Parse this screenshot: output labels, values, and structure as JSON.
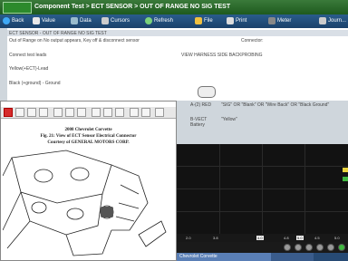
{
  "app": {
    "title": "Component Test > ECT SENSOR > OUT OF RANGE NO SIG TEST"
  },
  "toolbar": {
    "back": "Back",
    "value": "Value",
    "data": "Data",
    "cursors": "Cursors",
    "refresh": "Refresh",
    "file": "File",
    "print": "Print",
    "meter": "Meter",
    "journal": "Journ..."
  },
  "test": {
    "header": "ECT SENSOR - OUT OF RANGE NO SIG TEST",
    "instruction": "Out of Range on No output appears, Key off & disconnect sensor",
    "connect_test_leads": "Connect test leads",
    "yellow_label": "Yellow(+ECT)-Lead",
    "black_label": "Black (+ground) - Ground",
    "connector_label": "Connector:",
    "connector_value": "VIEW HARNESS SIDE BACKPROBING",
    "reading": "Reading",
    "lead_1": "A-(2) RED",
    "lead_1_desc": "\"SIG\" OR \"Blank\" OR \"Wire Back\" OR \"Black Ground\"",
    "lead_2": "B-VECT Battery",
    "lead_2_desc": "\"Yellow\""
  },
  "image_panel": {
    "caption_line1": "2008 Chevrolet Corvette",
    "caption_line2": "Fig. 21: View of ECT Sensor Electrical Connector",
    "caption_line3": "Courtesy of GENERAL MOTORS CORP."
  },
  "graph": {
    "tick_labels": [
      "2.0",
      "3.8",
      "4.0",
      "4.8",
      "5.0",
      "4.5",
      "5.0"
    ]
  },
  "taskbar": {
    "task": "Chevrolet Corvette"
  }
}
